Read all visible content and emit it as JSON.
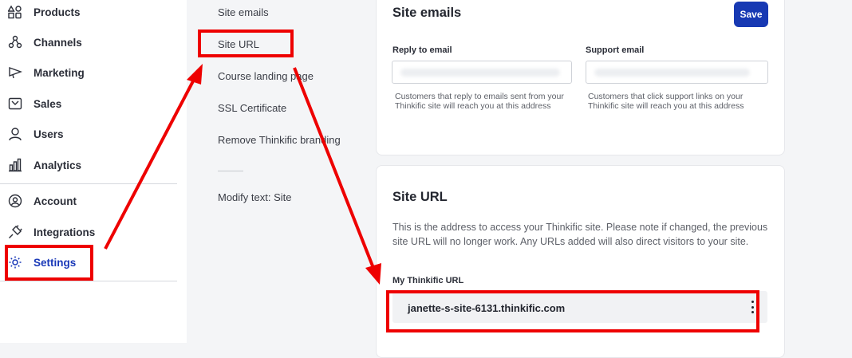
{
  "sidebar": {
    "items": [
      {
        "label": "Products",
        "icon": "shapes-icon"
      },
      {
        "label": "Channels",
        "icon": "channels-icon"
      },
      {
        "label": "Marketing",
        "icon": "megaphone-icon"
      },
      {
        "label": "Sales",
        "icon": "sales-icon"
      },
      {
        "label": "Users",
        "icon": "user-icon"
      },
      {
        "label": "Analytics",
        "icon": "bar-chart-icon"
      },
      {
        "label": "Account",
        "icon": "account-icon"
      },
      {
        "label": "Integrations",
        "icon": "plug-icon"
      },
      {
        "label": "Settings",
        "icon": "gear-icon",
        "active": true
      }
    ]
  },
  "subnav": {
    "items": [
      "Site emails",
      "Site URL",
      "Course landing page",
      "SSL Certificate",
      "Remove Thinkific branding",
      "Modify text: Site"
    ]
  },
  "site_emails": {
    "title": "Site emails",
    "save_label": "Save",
    "reply_label": "Reply to email",
    "support_label": "Support email",
    "reply_help": "Customers that reply to emails sent from your Thinkific site will reach you at this address",
    "support_help": "Customers that click support links on your Thinkific site will reach you at this address"
  },
  "site_url": {
    "title": "Site URL",
    "description": "This is the address to access your Thinkific site. Please note if changed, the previous site URL will no longer work. Any URLs added will also direct visitors to your site.",
    "field_label": "My Thinkific URL",
    "url_value": "janette-s-site-6131.thinkific.com"
  },
  "colors": {
    "accent": "#1739b3",
    "active_nav": "#1a39b8",
    "annotation": "#ee0000"
  }
}
